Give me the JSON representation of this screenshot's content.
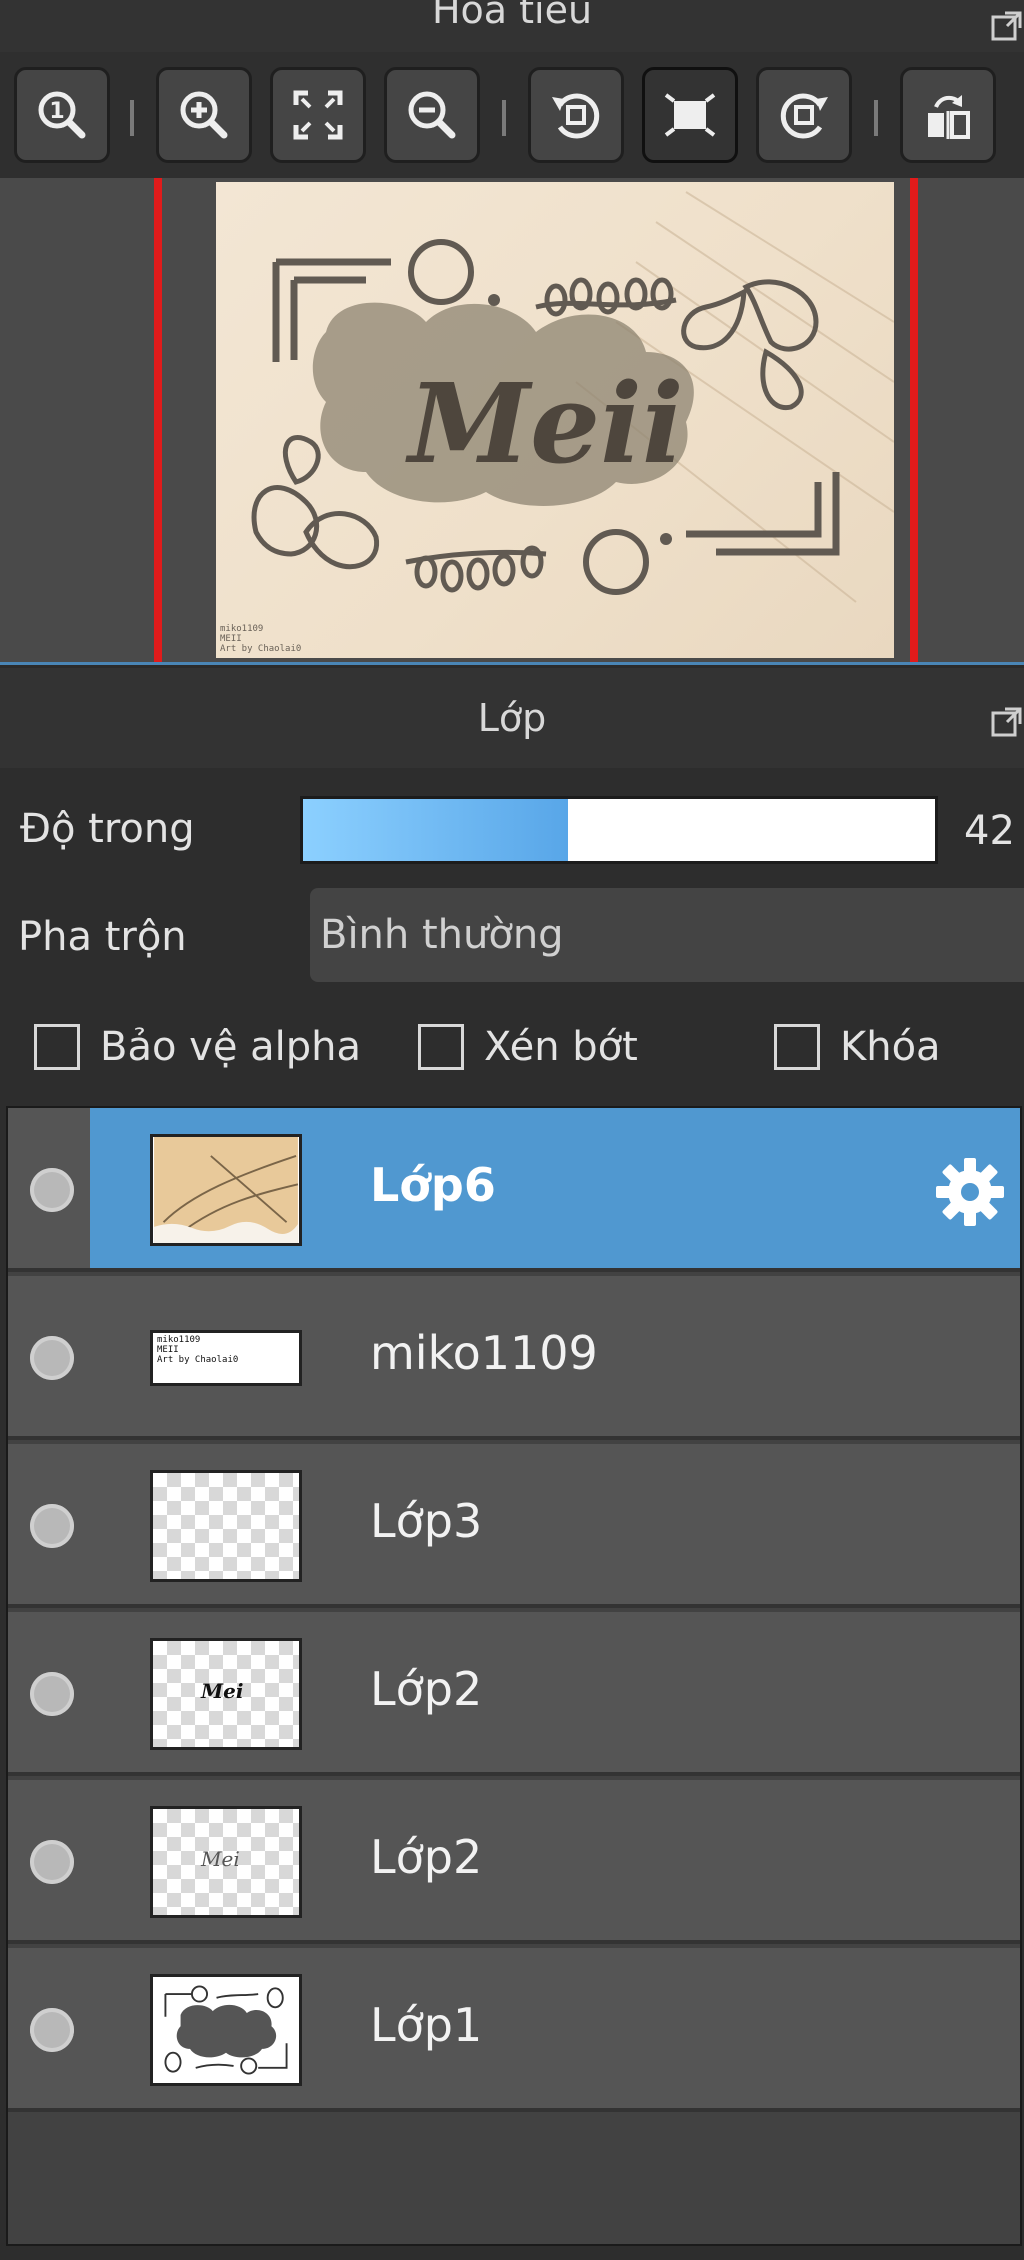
{
  "navigator": {
    "title": "Hoa tiêu",
    "toolbar": [
      {
        "name": "zoom-actual-size-button",
        "icon": "zoom-one-icon"
      },
      {
        "name": "zoom-in-button",
        "icon": "zoom-in-icon"
      },
      {
        "name": "fit-to-window-button",
        "icon": "fit-screen-icon"
      },
      {
        "name": "zoom-out-button",
        "icon": "zoom-out-icon"
      },
      {
        "name": "rotate-left-button",
        "icon": "rotate-left-icon"
      },
      {
        "name": "reset-view-button",
        "icon": "frame-icon",
        "active": true
      },
      {
        "name": "rotate-right-button",
        "icon": "rotate-right-icon"
      },
      {
        "name": "flip-horizontal-button",
        "icon": "flip-horizontal-icon"
      }
    ],
    "preview_text": "Meii",
    "watermark": "miko1109\nMEII\nArt by Chaolai0"
  },
  "layers_panel": {
    "title": "Lớp",
    "opacity_label": "Độ trong",
    "opacity_value": "42",
    "opacity_fraction": 0.42,
    "blend_label": "Pha trộn",
    "blend_mode": "Bình thường",
    "checkboxes": {
      "protect_alpha": "Bảo vệ alpha",
      "clipping": "Xén bớt",
      "lock": "Khóa"
    },
    "layers": [
      {
        "name": "Lớp6",
        "selected": true
      },
      {
        "name": "miko1109"
      },
      {
        "name": "Lớp3"
      },
      {
        "name": "Lớp2"
      },
      {
        "name": "Lớp2"
      },
      {
        "name": "Lớp1"
      }
    ],
    "thumb_text_miko": "miko1109\nMEII\nArt by Chaolai0",
    "thumb_text_layer2": "Mei"
  },
  "colors": {
    "selection": "#5098d0",
    "accent_line": "#4a86b6",
    "frame_red": "#e01b1b"
  }
}
